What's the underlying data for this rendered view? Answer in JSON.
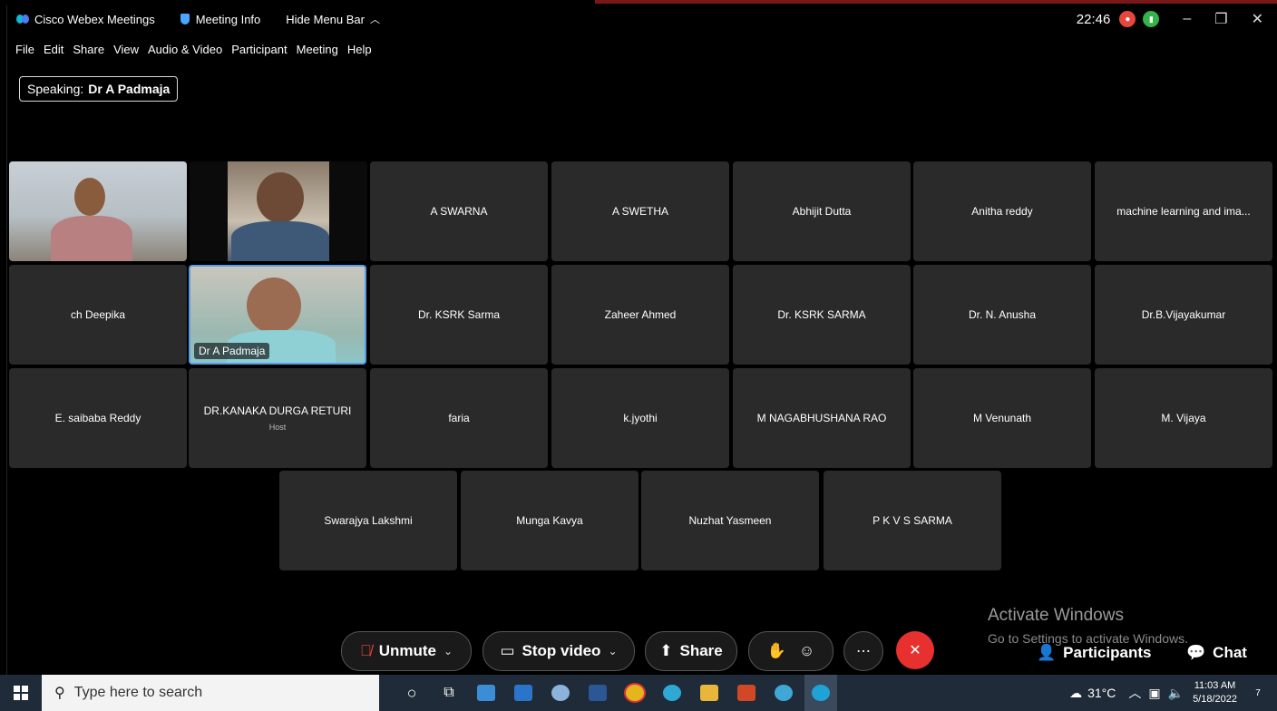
{
  "titlebar": {
    "app_name": "Cisco Webex Meetings",
    "meeting_info": "Meeting Info",
    "hide_menu": "Hide Menu Bar",
    "time": "22:46"
  },
  "menu": [
    "File",
    "Edit",
    "Share",
    "View",
    "Audio & Video",
    "Participant",
    "Meeting",
    "Help"
  ],
  "speaking": {
    "label": "Speaking:",
    "name": "Dr A Padmaja"
  },
  "participants": {
    "row1": [
      "A SWARNA",
      "A SWETHA",
      "Abhijit Dutta",
      "Anitha reddy",
      "machine learning and ima..."
    ],
    "row2_first": "ch Deepika",
    "row2_video_name": "Dr A Padmaja",
    "row2": [
      "Dr. KSRK Sarma",
      "Zaheer Ahmed",
      "Dr. KSRK SARMA",
      "Dr. N. Anusha",
      "Dr.B.Vijayakumar"
    ],
    "row3": [
      "E. saibaba Reddy",
      "DR.KANAKA DURGA RETURI",
      "faria",
      "k.jyothi",
      "M NAGABHUSHANA RAO",
      "M Venunath",
      "M. Vijaya"
    ],
    "host_label": "Host",
    "row4": [
      "Swarajya Lakshmi",
      "Munga Kavya",
      "Nuzhat Yasmeen",
      "P K V S SARMA"
    ]
  },
  "watermark": {
    "line1": "Activate Windows",
    "line2": "Go to Settings to activate Windows."
  },
  "controls": {
    "unmute": "Unmute",
    "stop_video": "Stop video",
    "share": "Share",
    "participants": "Participants",
    "chat": "Chat"
  },
  "taskbar": {
    "search_placeholder": "Type here to search",
    "weather": "31°C",
    "time": "11:03 AM",
    "date": "5/18/2022",
    "notif_count": "7"
  }
}
